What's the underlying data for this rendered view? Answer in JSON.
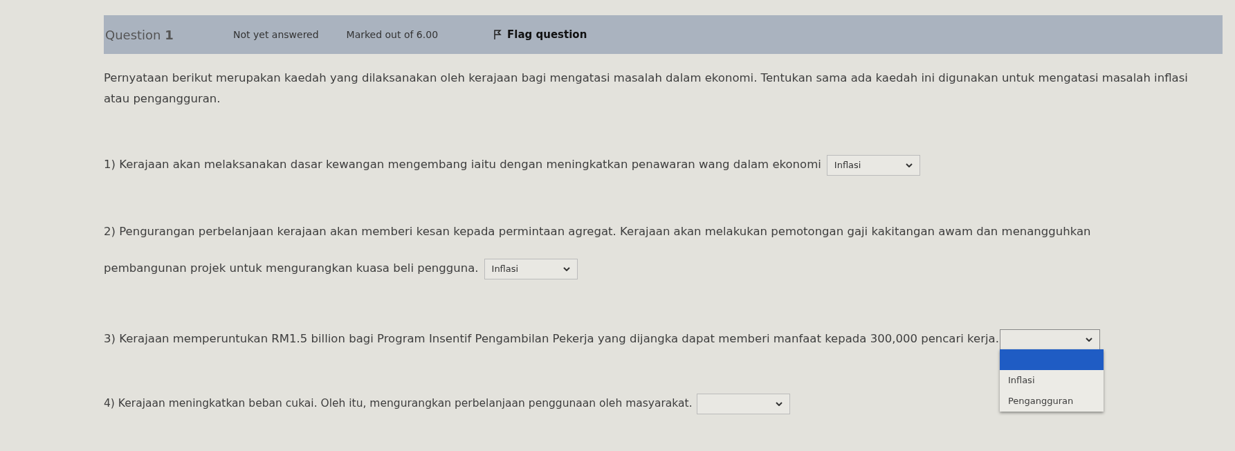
{
  "question_header": {
    "title": "Question",
    "number": "1",
    "status": "Not yet answered",
    "marks": "Marked out of 6.00",
    "flag_label": "Flag question"
  },
  "intro": "Pernyataan berikut merupakan kaedah yang dilaksanakan oleh kerajaan bagi mengatasi masalah dalam ekonomi. Tentukan sama ada kaedah ini digunakan untuk mengatasi masalah inflasi atau pengangguran.",
  "statements": [
    {
      "text": "1) Kerajaan akan melaksanakan dasar kewangan mengembang iaitu dengan meningkatkan penawaran wang dalam ekonomi",
      "select": {
        "value": "Inflasi",
        "open": false
      }
    },
    {
      "text": "2) Pengurangan perbelanjaan kerajaan akan memberi kesan kepada permintaan agregat. Kerajaan akan melakukan  pemotongan gaji kakitangan awam dan menangguhkan",
      "text_continued": "pembangunan projek untuk mengurangkan kuasa beli pengguna.",
      "select": {
        "value": "Inflasi",
        "open": false
      }
    },
    {
      "text": "3) Kerajaan memperuntukan RM1.5 billion bagi Program Insentif  Pengambilan Pekerja yang dijangka dapat memberi manfaat  kepada 300,000 pencari kerja.",
      "select": {
        "open": true,
        "blank_highlighted": true,
        "options": [
          {
            "label": "Inflasi",
            "selected": false
          },
          {
            "label": "Pengangguran",
            "selected": false
          }
        ]
      }
    },
    {
      "text": "4) Kerajaan meningkatkan beban cukai. Oleh itu, mengurangkan perbelanjaan penggunaan oleh masyarakat.",
      "select": {
        "open": false
      }
    }
  ]
}
